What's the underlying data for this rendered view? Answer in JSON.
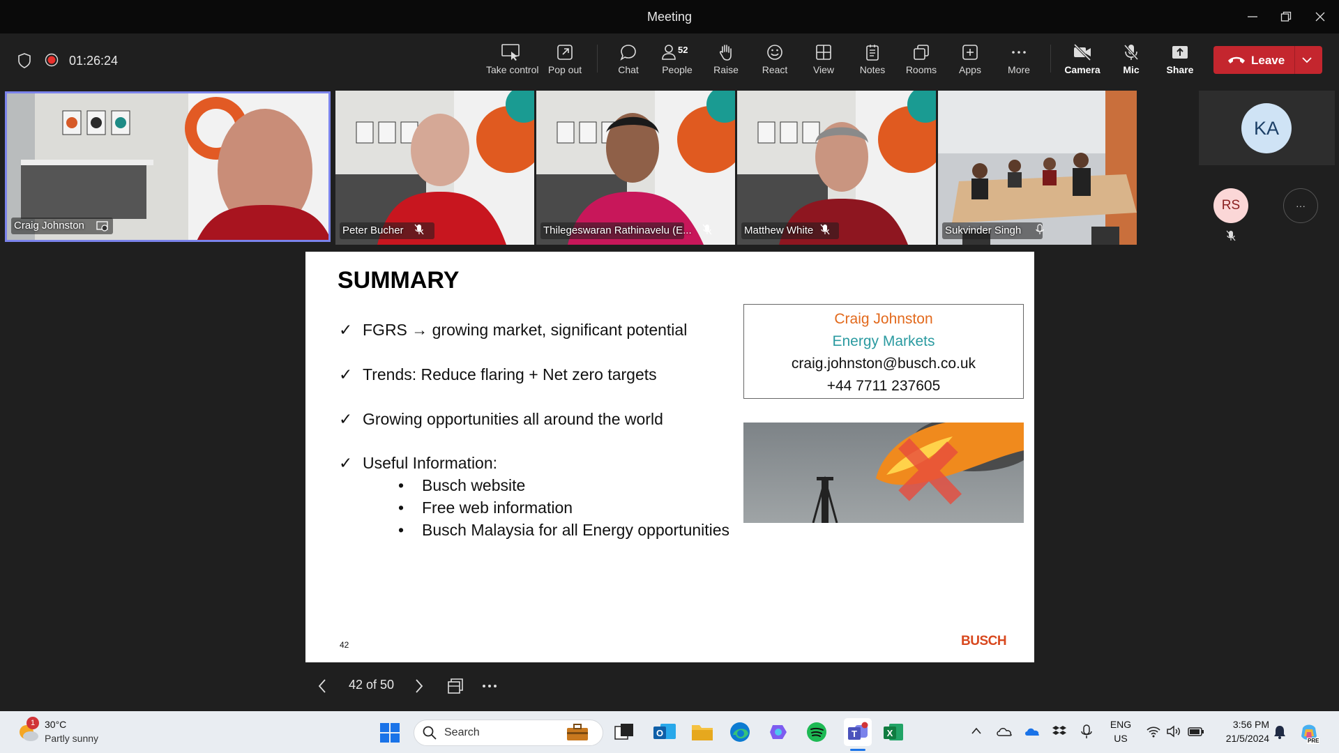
{
  "window": {
    "title": "Meeting"
  },
  "meeting": {
    "timer": "01:26:24"
  },
  "toolbar": {
    "take_control": "Take control",
    "pop_out": "Pop out",
    "chat": "Chat",
    "people": "People",
    "people_count": "52",
    "raise": "Raise",
    "react": "React",
    "view": "View",
    "notes": "Notes",
    "rooms": "Rooms",
    "apps": "Apps",
    "more": "More",
    "camera": "Camera",
    "mic": "Mic",
    "share": "Share",
    "leave": "Leave"
  },
  "participants": [
    {
      "name": "Craig Johnston"
    },
    {
      "name": "Peter Bucher"
    },
    {
      "name": "Thilegeswaran Rathinavelu (E..."
    },
    {
      "name": "Matthew White"
    },
    {
      "name": "Sukvinder Singh"
    }
  ],
  "avatars": {
    "ka": "KA",
    "rs": "RS",
    "more": "···"
  },
  "slide": {
    "title": "SUMMARY",
    "bullets": [
      "FGRS → growing market, significant potential",
      "Trends: Reduce flaring + Net zero targets",
      "Growing opportunities all around the world",
      "Useful Information:"
    ],
    "check": "✓",
    "dot": "•",
    "sub_bullets": [
      "Busch website",
      "Free web information",
      "Busch Malaysia for all Energy opportunities"
    ],
    "contact": {
      "name": "Craig Johnston",
      "role": "Energy  Markets",
      "email": "craig.johnston@busch.co.uk",
      "phone": "+44 7711 237605"
    },
    "page_number": "42",
    "logo": "BUSCH",
    "colors": {
      "name": "#e2691c",
      "role": "#2a9aa0"
    }
  },
  "slide_nav": {
    "counter": "42 of 50"
  },
  "taskbar": {
    "weather_temp": "30°C",
    "weather_desc": "Partly sunny",
    "weather_badge": "1",
    "search": "Search",
    "lang1": "ENG",
    "lang2": "US",
    "time": "3:56 PM",
    "date": "21/5/2024",
    "copilot_badge": "PRE"
  }
}
